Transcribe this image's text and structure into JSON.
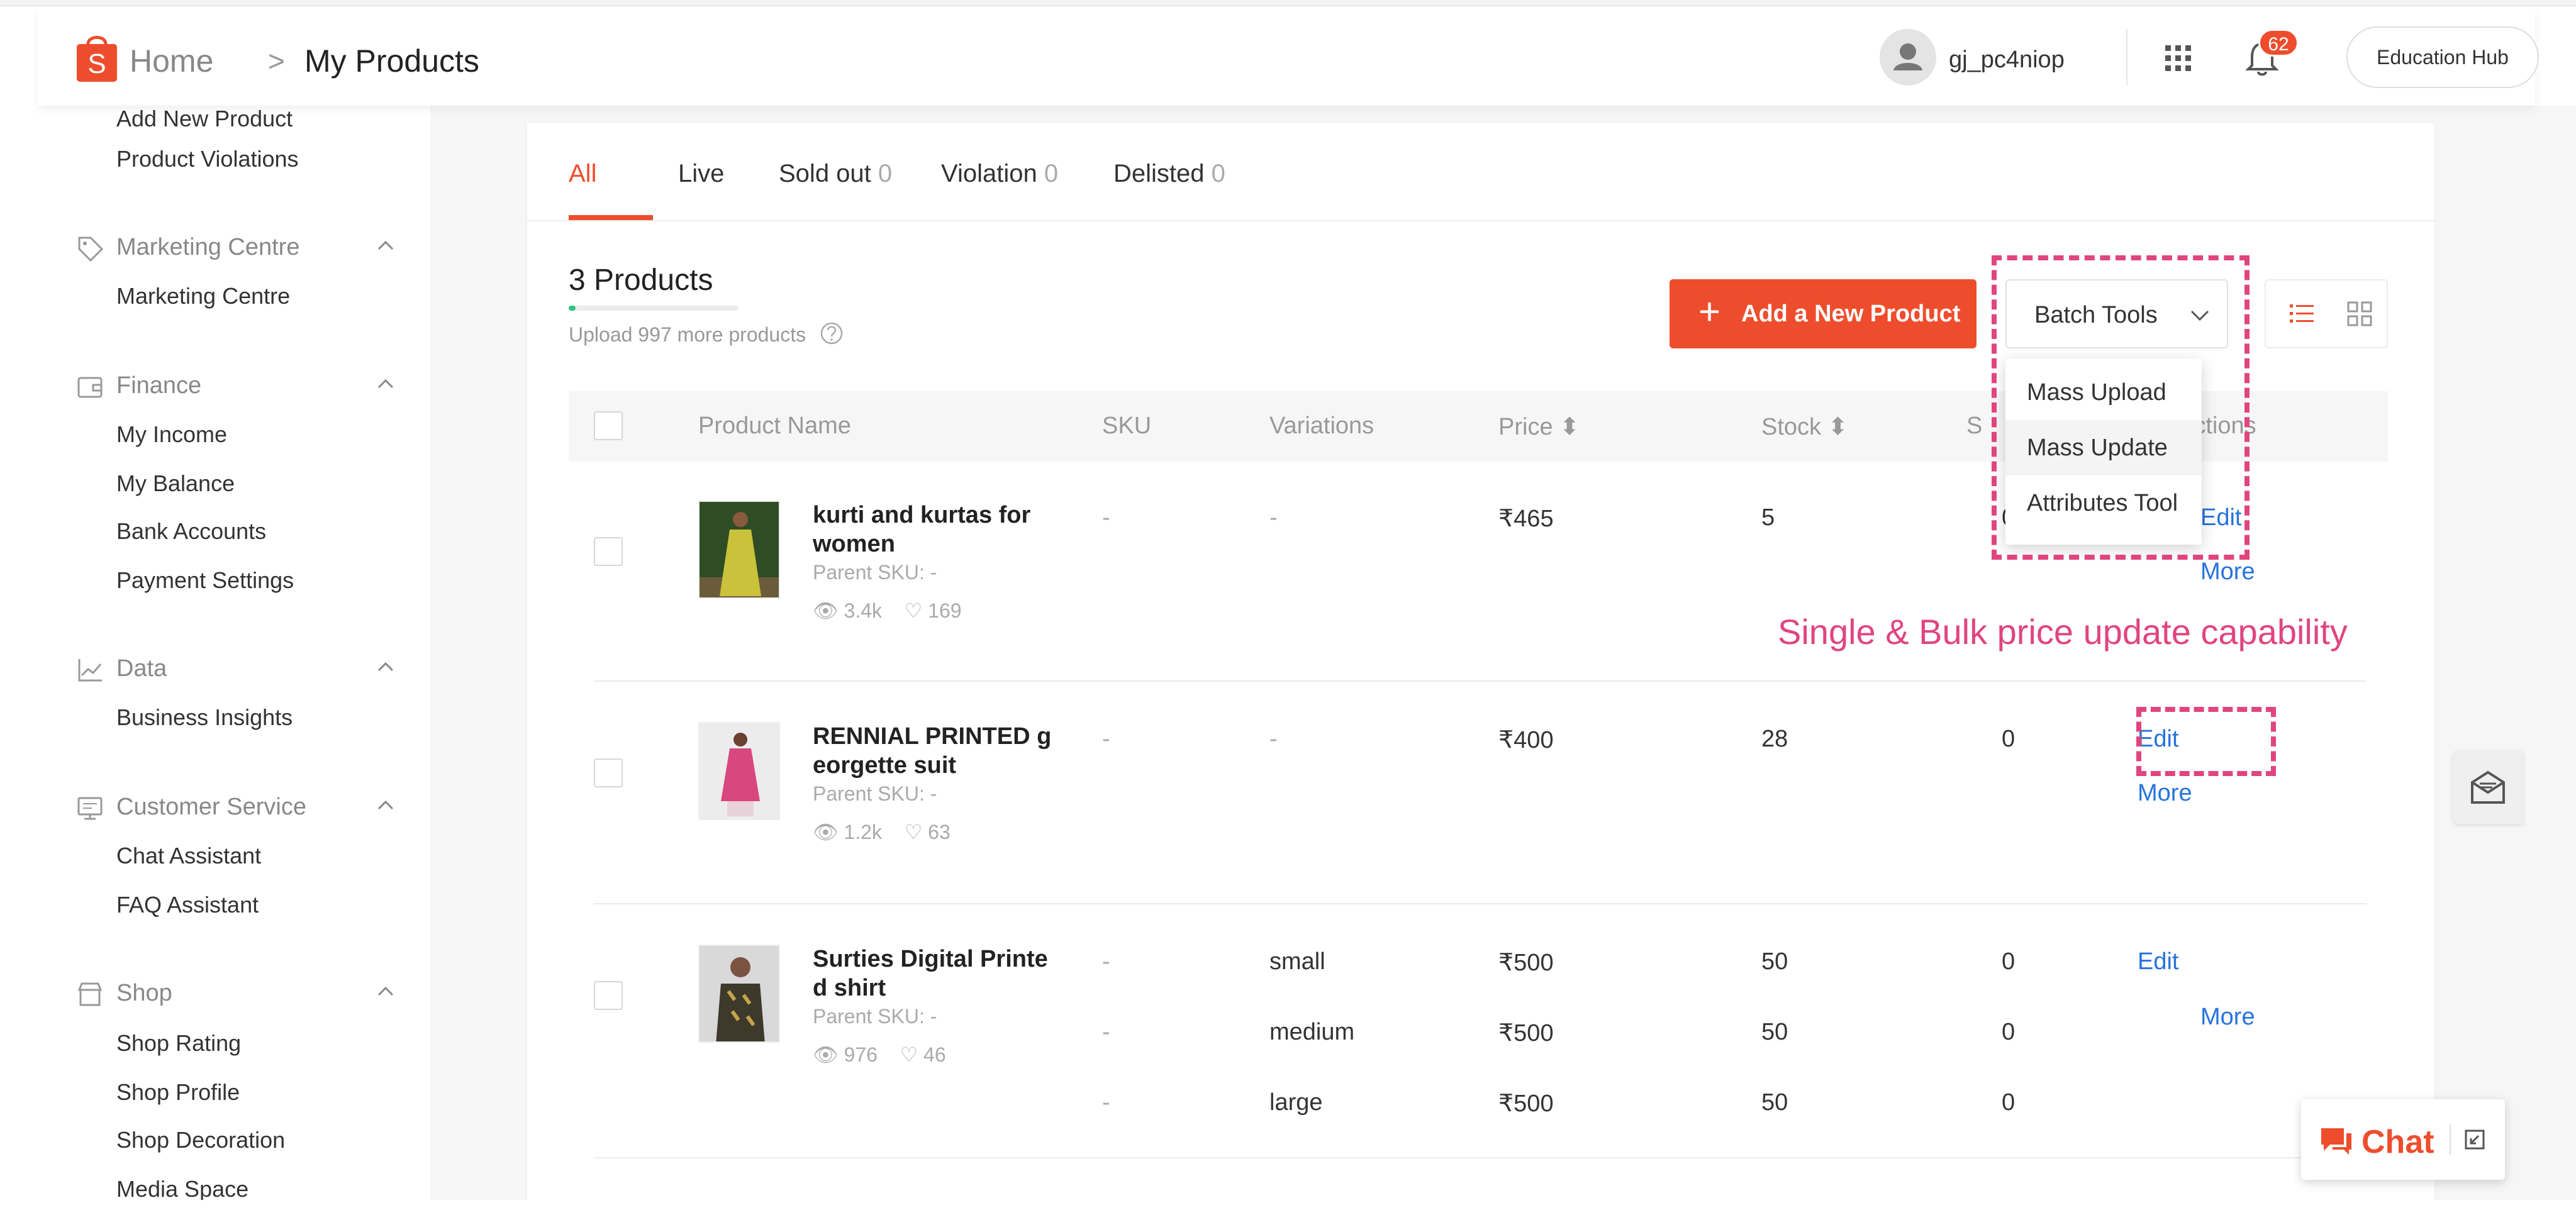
{
  "header": {
    "breadcrumb_home": "Home",
    "breadcrumb_separator": ">",
    "breadcrumb_current": "My Products",
    "username": "gj_pc4niop",
    "notification_count": "62",
    "education_hub": "Education Hub",
    "logo_letter": "S",
    "brand_color": "#ee4d2d"
  },
  "sidebar": {
    "products_links": [
      "Add New Product",
      "Product Violations"
    ],
    "marketing": {
      "title": "Marketing Centre",
      "icon": "tag-icon",
      "links": [
        "Marketing Centre"
      ]
    },
    "finance": {
      "title": "Finance",
      "icon": "wallet-icon",
      "links": [
        "My Income",
        "My Balance",
        "Bank Accounts",
        "Payment Settings"
      ]
    },
    "data": {
      "title": "Data",
      "icon": "chart-line-icon",
      "links": [
        "Business Insights"
      ]
    },
    "customer_service": {
      "title": "Customer Service",
      "icon": "monitor-icon",
      "links": [
        "Chat Assistant",
        "FAQ Assistant"
      ]
    },
    "shop": {
      "title": "Shop",
      "icon": "shop-icon",
      "links": [
        "Shop Rating",
        "Shop Profile",
        "Shop Decoration",
        "Media Space"
      ]
    }
  },
  "tabs": [
    {
      "label": "All",
      "count": ""
    },
    {
      "label": "Live",
      "count": ""
    },
    {
      "label": "Sold out",
      "count": "0"
    },
    {
      "label": "Violation",
      "count": "0"
    },
    {
      "label": "Delisted",
      "count": "0"
    }
  ],
  "summary": {
    "title": "3 Products",
    "upload_note": "Upload 997 more products",
    "upload_progress": 0.04
  },
  "toolbar": {
    "add_label": "Add a New Product",
    "batch_label": "Batch Tools"
  },
  "batch_menu": [
    "Mass Upload",
    "Mass Update",
    "Attributes Tool"
  ],
  "table": {
    "headers": {
      "name": "Product Name",
      "sku": "SKU",
      "variations": "Variations",
      "price": "Price",
      "stock": "Stock",
      "sales": "S",
      "actions": "Actions"
    },
    "rows": [
      {
        "name_line1": "kurti and kurtas for",
        "name_line2": "women",
        "parent_sku": "Parent SKU: -",
        "views": "3.4k",
        "likes": "169",
        "sku": "-",
        "variation": "-",
        "price": "₹465",
        "stock": "5",
        "sales": "0",
        "edit": "Edit",
        "more": "More"
      },
      {
        "name_line1": "RENNIAL PRINTED g",
        "name_line2": "eorgette suit",
        "parent_sku": "Parent SKU: -",
        "views": "1.2k",
        "likes": "63",
        "sku": "-",
        "variation": "-",
        "price": "₹400",
        "stock": "28",
        "sales": "0",
        "edit": "Edit",
        "more": "More"
      },
      {
        "name_line1": "Surties Digital Printe",
        "name_line2": "d shirt",
        "parent_sku": "Parent SKU: -",
        "views": "976",
        "likes": "46",
        "edit": "Edit",
        "more": "More",
        "variants": [
          {
            "sku": "-",
            "variation": "small",
            "price": "₹500",
            "stock": "50",
            "sales": "0"
          },
          {
            "sku": "-",
            "variation": "medium",
            "price": "₹500",
            "stock": "50",
            "sales": "0"
          },
          {
            "sku": "-",
            "variation": "large",
            "price": "₹500",
            "stock": "50",
            "sales": "0"
          }
        ]
      }
    ]
  },
  "annotation": {
    "text": "Single & Bulk price update capability",
    "color": "#e0457f"
  },
  "chat": {
    "label": "Chat"
  }
}
